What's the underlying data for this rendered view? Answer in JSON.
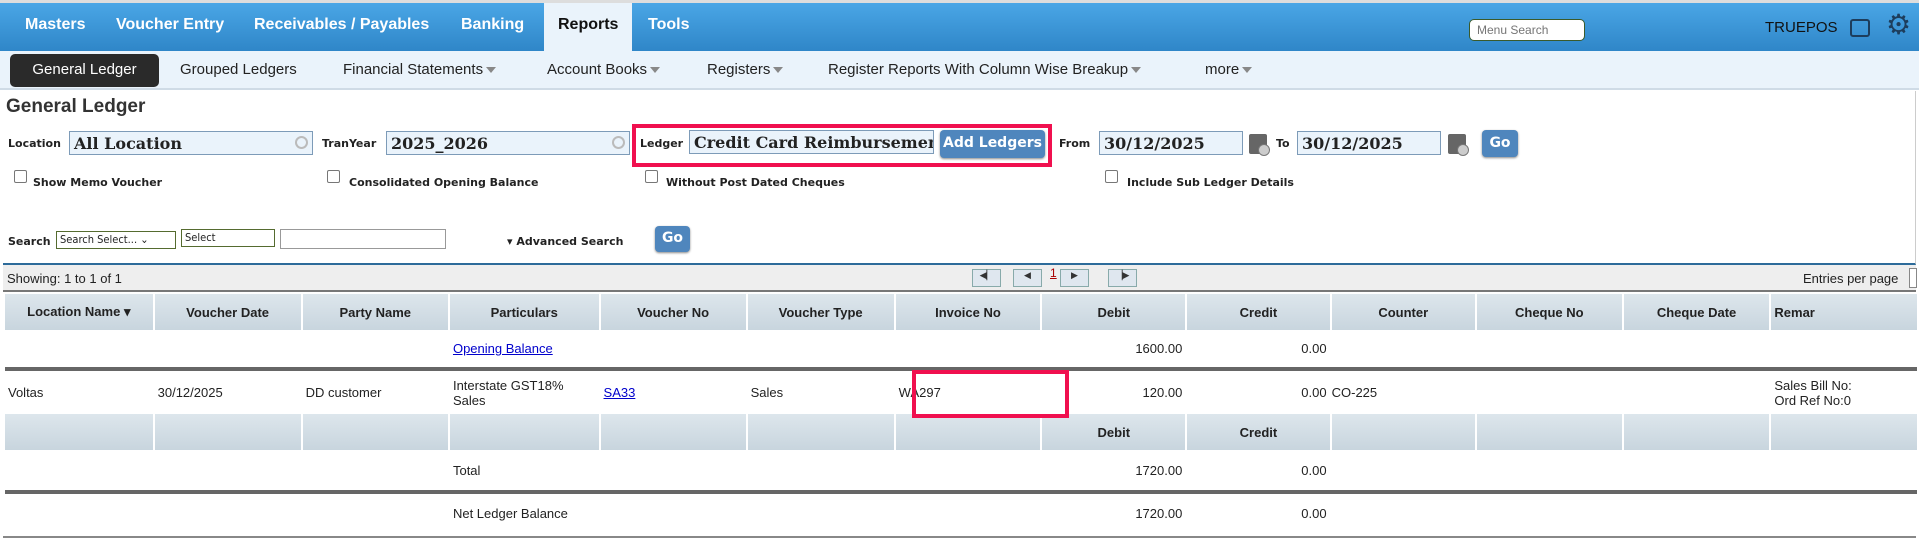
{
  "topnav": {
    "items": [
      "Masters",
      "Voucher Entry",
      "Receivables / Payables",
      "Banking",
      "Reports",
      "Tools"
    ],
    "active": "Reports",
    "menu_search_placeholder": "Menu Search",
    "user": "TRUEPOS"
  },
  "subnav": {
    "items": [
      {
        "label": "General Ledger",
        "dropdown": false
      },
      {
        "label": "Grouped Ledgers",
        "dropdown": false
      },
      {
        "label": "Financial Statements",
        "dropdown": true
      },
      {
        "label": "Account Books",
        "dropdown": true
      },
      {
        "label": "Registers",
        "dropdown": true
      },
      {
        "label": "Register Reports With Column Wise Breakup",
        "dropdown": true
      },
      {
        "label": "more",
        "dropdown": true
      }
    ]
  },
  "page_title": "General Ledger",
  "filters": {
    "location_label": "Location",
    "location": "All Location",
    "tranyear_label": "TranYear",
    "tranyear": "2025_2026",
    "ledger_label": "Ledger",
    "ledger": "Credit Card Reimbursement(",
    "add_ledgers": "Add Ledgers",
    "from_label": "From",
    "from": "30/12/2025",
    "to_label": "To",
    "to": "30/12/2025",
    "go": "Go"
  },
  "checkboxes": [
    {
      "label": "Show Memo Voucher",
      "checked": false
    },
    {
      "label": "Consolidated Opening Balance",
      "checked": false
    },
    {
      "label": "Without Post Dated Cheques",
      "checked": false
    },
    {
      "label": "Include Sub Ledger Details",
      "checked": false
    }
  ],
  "search": {
    "label": "Search",
    "field": "Search Select...",
    "operator": "Select",
    "value": "",
    "advanced": "Advanced Search",
    "go": "Go"
  },
  "pager": {
    "showing": "Showing: 1 to 1 of 1",
    "page": "1",
    "entries_label": "Entries per page"
  },
  "table": {
    "columns": [
      "Location Name",
      "Voucher Date",
      "Party Name",
      "Particulars",
      "Voucher No",
      "Voucher Type",
      "Invoice No",
      "Debit",
      "Credit",
      "Counter",
      "Cheque No",
      "Cheque Date",
      "Remar"
    ],
    "opening": {
      "particulars": "Opening Balance",
      "debit": "1600.00",
      "credit": "0.00"
    },
    "rows": [
      {
        "location": "Voltas",
        "date": "30/12/2025",
        "party": "DD customer",
        "particulars_1": "Interstate GST18%",
        "particulars_2": "Sales",
        "voucher_no": "SA33",
        "voucher_type": "Sales",
        "invoice_no": "WA297",
        "debit": "120.00",
        "credit": "0.00",
        "counter": "CO-225",
        "cheque_no": "",
        "cheque_date": "",
        "remarks_1": "Sales Bill No:",
        "remarks_2": "Ord Ref No:0"
      }
    ],
    "summary_header": {
      "debit": "Debit",
      "credit": "Credit"
    },
    "total": {
      "label": "Total",
      "debit": "1720.00",
      "credit": "0.00"
    },
    "net": {
      "label": "Net Ledger Balance",
      "debit": "1720.00",
      "credit": "0.00"
    }
  },
  "colors": {
    "nav_blue": "#3a95d8",
    "highlight": "#f0104f",
    "button": "#4f86bd"
  }
}
